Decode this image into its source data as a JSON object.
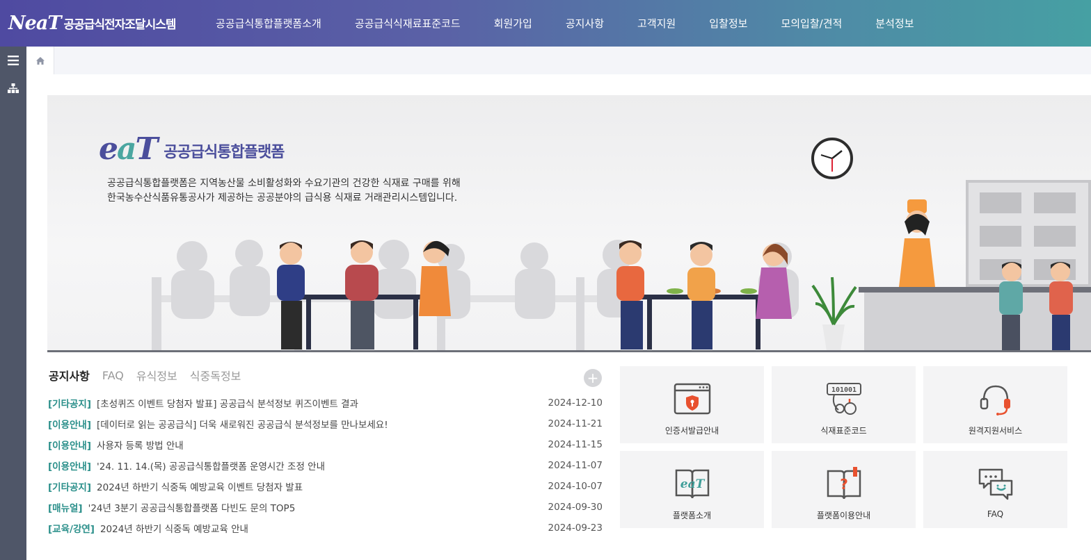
{
  "header": {
    "logo_mark": "NeaT",
    "logo_text": "공공급식전자조달시스템",
    "nav": [
      "공공급식통합플랫폼소개",
      "공공급식식재료표준코드",
      "회원가입",
      "공지사항",
      "고객지원",
      "입찰정보",
      "모의입찰/견적",
      "분석정보"
    ]
  },
  "rail": {
    "icons": [
      "menu-icon",
      "sitemap-icon"
    ]
  },
  "breadcrumb": {
    "icon": "home-icon"
  },
  "banner": {
    "brand_mark": "eaT",
    "brand_name": "공공급식통합플랫폼",
    "desc_line1": "공공급식통합플랫폼은 지역농산물 소비활성화와 수요기관의 건강한 식재료 구매를 위해",
    "desc_line2": "한국농수산식품유통공사가 제공하는 공공분야의 급식용 식재료 거래관리시스템입니다."
  },
  "notice": {
    "tabs": [
      "공지사항",
      "FAQ",
      "유식정보",
      "식중독정보"
    ],
    "more_label": "+",
    "items": [
      {
        "cat": "[기타공지]",
        "title": "[초성퀴즈 이벤트 당첨자 발표] 공공급식 분석정보 퀴즈이벤트 결과",
        "date": "2024-12-10"
      },
      {
        "cat": "[이용안내]",
        "title": "[데이터로 읽는 공공급식] 더욱 새로워진 공공급식 분석정보를 만나보세요!",
        "date": "2024-11-21"
      },
      {
        "cat": "[이용안내]",
        "title": "사용자 등록 방법 안내",
        "date": "2024-11-15"
      },
      {
        "cat": "[이용안내]",
        "title": "'24. 11. 14.(목) 공공급식통합플랫폼 운영시간 조정 안내",
        "date": "2024-11-07"
      },
      {
        "cat": "[기타공지]",
        "title": "2024년 하반기 식중독 예방교육 이벤트 당첨자 발표",
        "date": "2024-10-07"
      },
      {
        "cat": "[매뉴얼]",
        "title": "'24년 3분기 공공급식통합플랫폼 다빈도 문의 TOP5",
        "date": "2024-09-30"
      },
      {
        "cat": "[교육/강연]",
        "title": "2024년 하반기 식중독 예방교육 안내",
        "date": "2024-09-23"
      }
    ]
  },
  "tiles": [
    {
      "label": "인증서발급안내",
      "icon": "certificate-icon"
    },
    {
      "label": "식재표준코드",
      "icon": "food-code-icon",
      "icon_text": "101001"
    },
    {
      "label": "원격지원서비스",
      "icon": "headset-icon"
    },
    {
      "label": "플랫폼소개",
      "icon": "eat-book-icon",
      "icon_text": "eaT"
    },
    {
      "label": "플랫폼이용안내",
      "icon": "guide-book-icon",
      "icon_text": "?"
    },
    {
      "label": "FAQ",
      "icon": "chat-bubbles-icon"
    }
  ],
  "colors": {
    "accent": "#2a8f8a",
    "brand": "#4b4e9c",
    "rail": "#4f5668"
  }
}
